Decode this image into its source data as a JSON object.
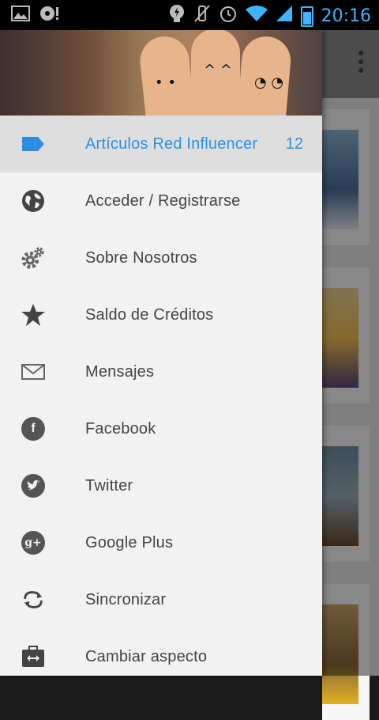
{
  "status_bar": {
    "time": "20:16"
  },
  "menu": {
    "items": [
      {
        "label": "Artículos Red Influencer",
        "count": "12",
        "icon": "label-tag-icon",
        "active": true
      },
      {
        "label": "Acceder / Registrarse",
        "icon": "globe-icon"
      },
      {
        "label": "Sobre Nosotros",
        "icon": "gears-icon"
      },
      {
        "label": "Saldo de Créditos",
        "icon": "star-icon"
      },
      {
        "label": "Mensajes",
        "icon": "envelope-icon"
      },
      {
        "label": "Facebook",
        "icon": "facebook-icon",
        "glyph": "f"
      },
      {
        "label": "Twitter",
        "icon": "twitter-icon",
        "glyph": "🐦"
      },
      {
        "label": "Google Plus",
        "icon": "google-plus-icon",
        "glyph": "g+"
      },
      {
        "label": "Sincronizar",
        "icon": "sync-icon"
      },
      {
        "label": "Cambiar aspecto",
        "icon": "switch-view-icon"
      }
    ]
  },
  "colors": {
    "accent": "#2e8fe0",
    "status_accent": "#3db5ff",
    "drawer_bg": "#f2f2f2",
    "active_bg": "#dedede",
    "icon": "#555555"
  }
}
